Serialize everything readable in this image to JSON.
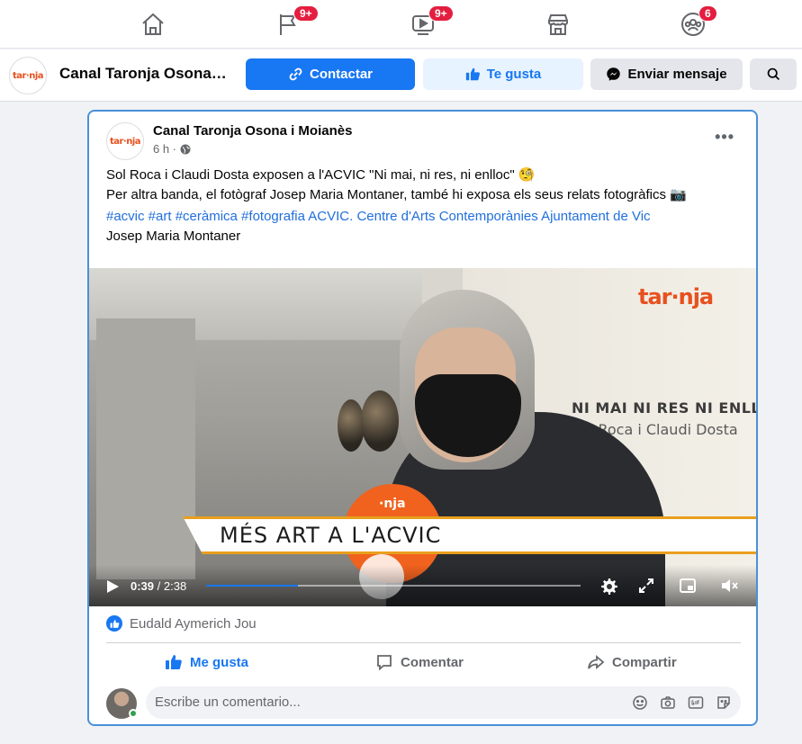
{
  "nav": {
    "items": [
      {
        "icon": "home-icon",
        "badge": ""
      },
      {
        "icon": "flag-icon",
        "badge": "9+"
      },
      {
        "icon": "video-icon",
        "badge": "9+"
      },
      {
        "icon": "marketplace-icon",
        "badge": ""
      },
      {
        "icon": "groups-icon",
        "badge": "6"
      }
    ]
  },
  "page_header": {
    "logo_text": "tar·nja",
    "name": "Canal Taronja Osona i Moianès",
    "contact_label": "Contactar",
    "like_label": "Te gusta",
    "message_label": "Enviar mensaje"
  },
  "post": {
    "author": "Canal Taronja Osona i Moianès",
    "time": "6 h ·",
    "text_line1": "Sol Roca i Claudi Dosta exposen a l'ACVIC \"Ni mai, ni res, ni enlloc\" 🧐",
    "text_line2": "Per altra banda, el fotògraf Josep Maria Montaner, també hi exposa els seus relats fotogràfics 📷",
    "tags": "#acvic #art #ceràmica #fotografia ACVIC. Centre d'Arts Contemporànies Ajuntament de Vic",
    "tag_person": "Josep Maria Montaner",
    "video": {
      "logo_text": "tar·nja",
      "title_line1": "NI MAI NI RES NI ENLLOC",
      "title_line2": "Sol Roca i Claudi Dosta",
      "banner": "MÉS ART A L'ACVIC",
      "mic_text": "·nja",
      "current_time": "0:39",
      "duration": "/ 2:38",
      "progress": 0.246
    },
    "reactions_text": "Eudald Aymerich Jou",
    "actions": {
      "like": "Me gusta",
      "comment": "Comentar",
      "share": "Compartir"
    },
    "comment_placeholder": "Escribe un comentario..."
  },
  "colors": {
    "brand_blue": "#1877f2",
    "taronja_orange": "#e8501e",
    "badge_red": "#e41e3f"
  }
}
